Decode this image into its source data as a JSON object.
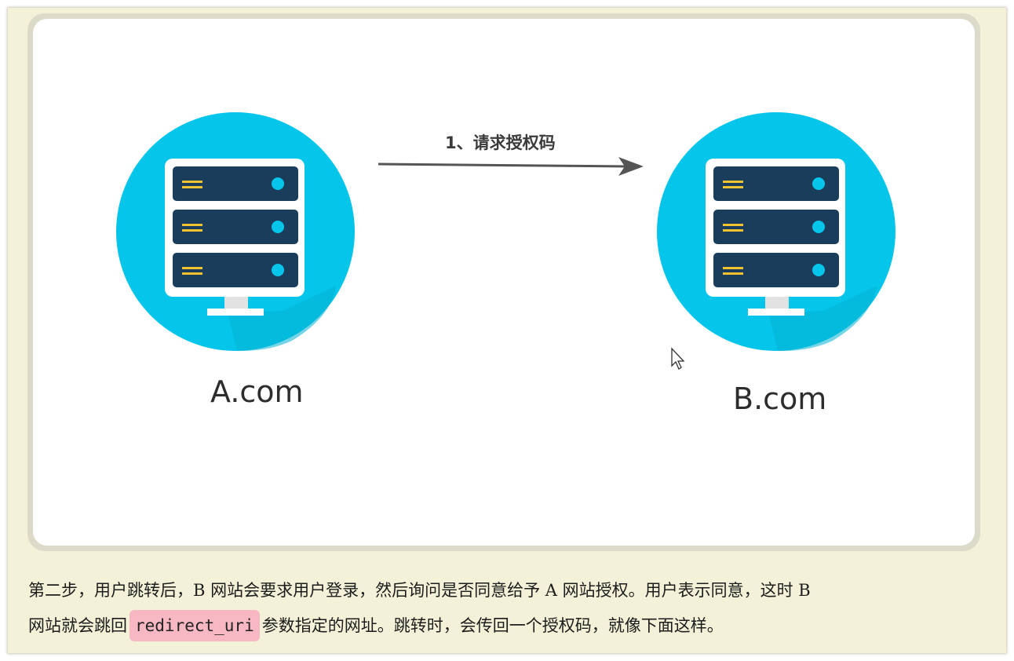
{
  "figure": {
    "arrow_label": "1、请求授权码",
    "left_server_label": "A.com",
    "right_server_label": "B.com"
  },
  "paragraph": {
    "line1": "第二步，用户跳转后，B 网站会要求用户登录，然后询问是否同意给予 A 网站授权。用户表示同意，这时 B",
    "line2_before": "网站就会跳回",
    "code": "redirect_uri",
    "line2_after": "参数指定的网址。跳转时，会传回一个授权码，就像下面这样。"
  },
  "colors": {
    "page_background": "#f3f2d8",
    "circle": "#05c5ea",
    "server_unit": "#1a3d5c",
    "code_highlight": "#f7b8c3"
  }
}
